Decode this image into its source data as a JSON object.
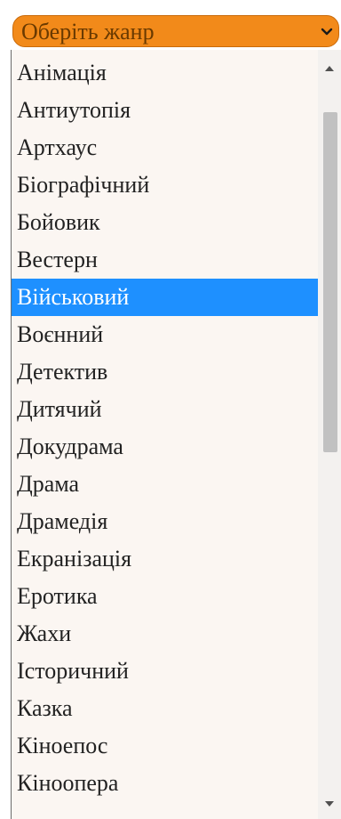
{
  "select": {
    "label": "Оберіть жанр",
    "color": "#f28a1a",
    "arrow_icon": "chevron-down-icon"
  },
  "dropdown": {
    "selected_index": 6,
    "highlight_color": "#1e90ff",
    "options": [
      "Анімація",
      "Антиутопія",
      "Артхаус",
      "Біографічний",
      "Бойовик",
      "Вестерн",
      "Військовий",
      "Воєнний",
      "Детектив",
      "Дитячий",
      "Докудрама",
      "Драма",
      "Драмедія",
      "Екранізація",
      "Еротика",
      "Жахи",
      "Історичний",
      "Казка",
      "Кіноепос",
      "Кіноопера"
    ]
  },
  "scrollbar": {
    "up_icon": "scroll-up-arrow-icon",
    "down_icon": "scroll-down-arrow-icon"
  }
}
